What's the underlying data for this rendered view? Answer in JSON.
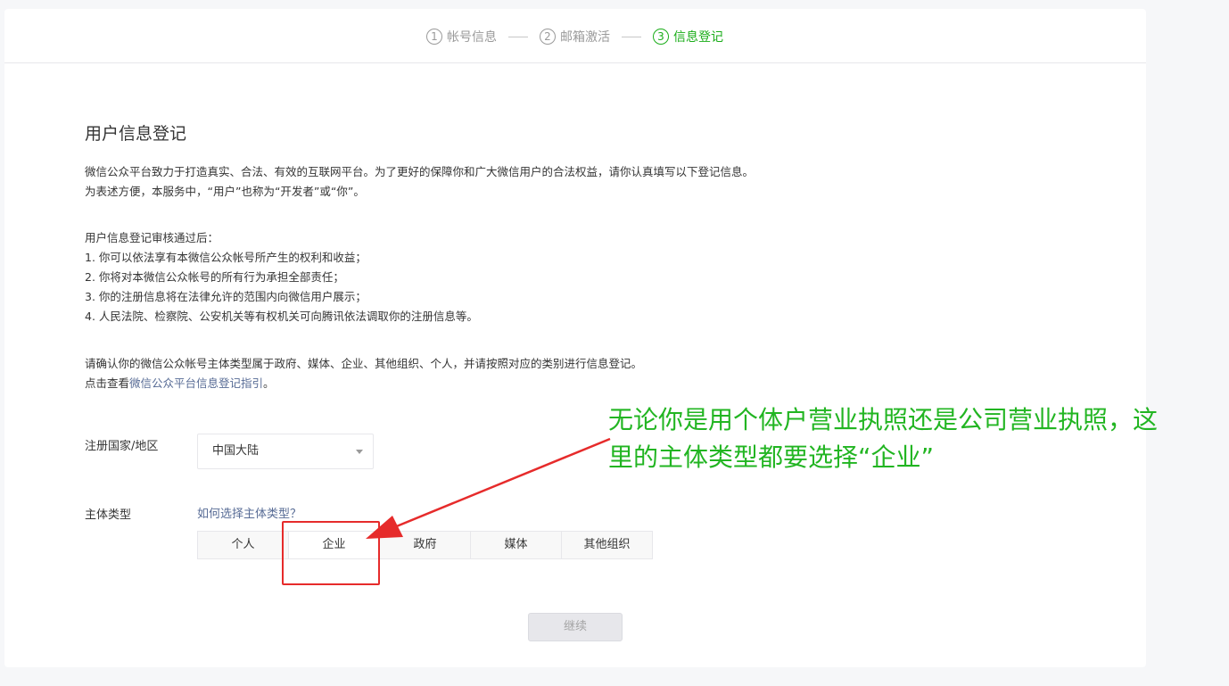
{
  "steps": [
    {
      "num": "1",
      "label": "帐号信息"
    },
    {
      "num": "2",
      "label": "邮箱激活"
    },
    {
      "num": "3",
      "label": "信息登记"
    }
  ],
  "title": "用户信息登记",
  "intro": [
    "微信公众平台致力于打造真实、合法、有效的互联网平台。为了更好的保障你和广大微信用户的合法权益，请你认真填写以下登记信息。",
    "为表述方便，本服务中，“用户”也称为“开发者”或“你”。"
  ],
  "after_review": {
    "heading": "用户信息登记审核通过后：",
    "items": [
      "1. 你可以依法享有本微信公众帐号所产生的权利和收益；",
      "2. 你将对本微信公众帐号的所有行为承担全部责任；",
      "3. 你的注册信息将在法律允许的范围内向微信用户展示；",
      "4. 人民法院、检察院、公安机关等有权机关可向腾讯依法调取你的注册信息等。"
    ]
  },
  "confirm": {
    "line1": "请确认你的微信公众帐号主体类型属于政府、媒体、企业、其他组织、个人，并请按照对应的类别进行信息登记。",
    "line2_prefix": "点击查看",
    "line2_link": "微信公众平台信息登记指引",
    "line2_suffix": "。"
  },
  "region": {
    "label": "注册国家/地区",
    "value": "中国大陆"
  },
  "subject": {
    "label": "主体类型",
    "help_link": "如何选择主体类型？",
    "options": [
      "个人",
      "企业",
      "政府",
      "媒体",
      "其他组织"
    ]
  },
  "continue_button": "继续",
  "annotation": "无论你是用个体户营业执照还是公司营业执照，这里的主体类型都要选择“企业”",
  "colors": {
    "active_step": "#1aad19",
    "link": "#576b95",
    "annotation_text": "#22b522",
    "annotation_marks": "#e62b2b"
  }
}
